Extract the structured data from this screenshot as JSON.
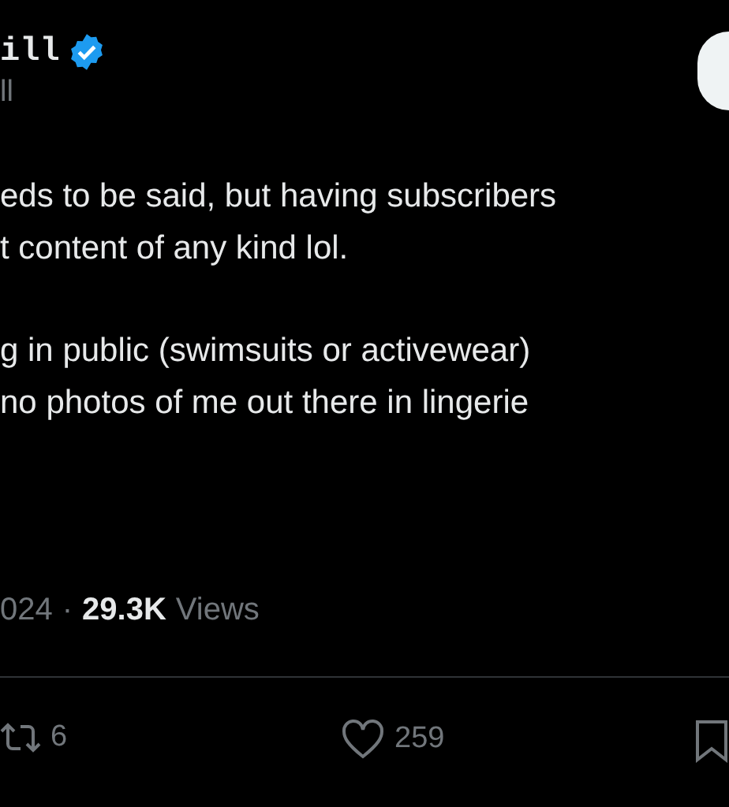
{
  "author": {
    "name": "ill",
    "verified": true,
    "handle": "ll"
  },
  "body": {
    "paragraphs": [
      [
        "eds to be said, but having subscribers",
        "t content of any kind lol."
      ],
      [
        "g in public (swimsuits or activewear)",
        "no photos of me out there in lingerie"
      ]
    ]
  },
  "meta": {
    "date": "024",
    "separator": "·",
    "views_count": "29.3K",
    "views_label": "Views"
  },
  "actions": [
    {
      "kind": "retweet",
      "count": "6"
    },
    {
      "kind": "like",
      "count": "259"
    },
    {
      "kind": "bookmark"
    }
  ]
}
